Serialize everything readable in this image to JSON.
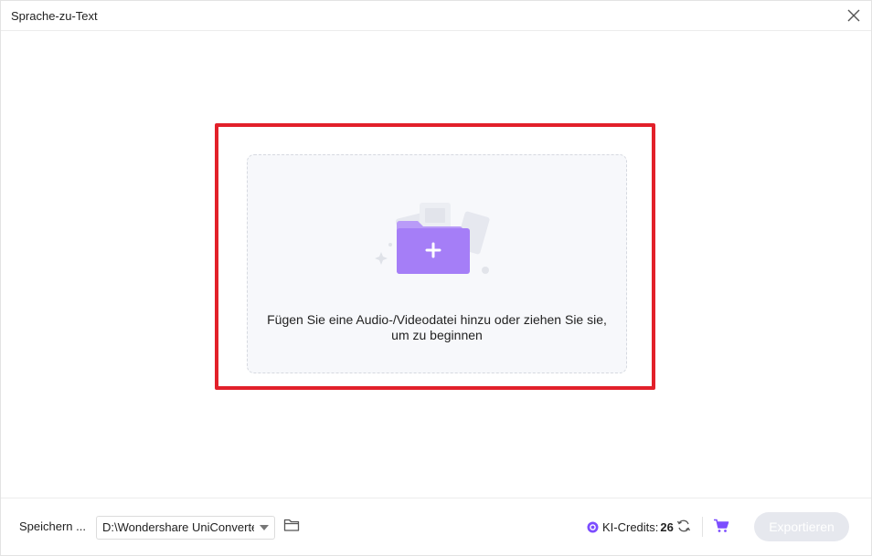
{
  "window": {
    "title": "Sprache-zu-Text"
  },
  "dropzone": {
    "message": "Fügen Sie eine Audio-/Videodatei hinzu oder ziehen Sie sie, um zu beginnen",
    "highlight_color": "#e2202a",
    "folder_color": "#a57ef7"
  },
  "footer": {
    "save_label": "Speichern ...",
    "save_path": "D:\\Wondershare UniConverte",
    "credits_label": "KI-Credits:",
    "credits_count": "26",
    "export_label": "Exportieren",
    "accent_color": "#7c4dff"
  },
  "icons": {
    "close": "close-icon",
    "folder": "folder-icon",
    "credits": "credits-icon",
    "refresh": "refresh-icon",
    "cart": "cart-icon"
  }
}
